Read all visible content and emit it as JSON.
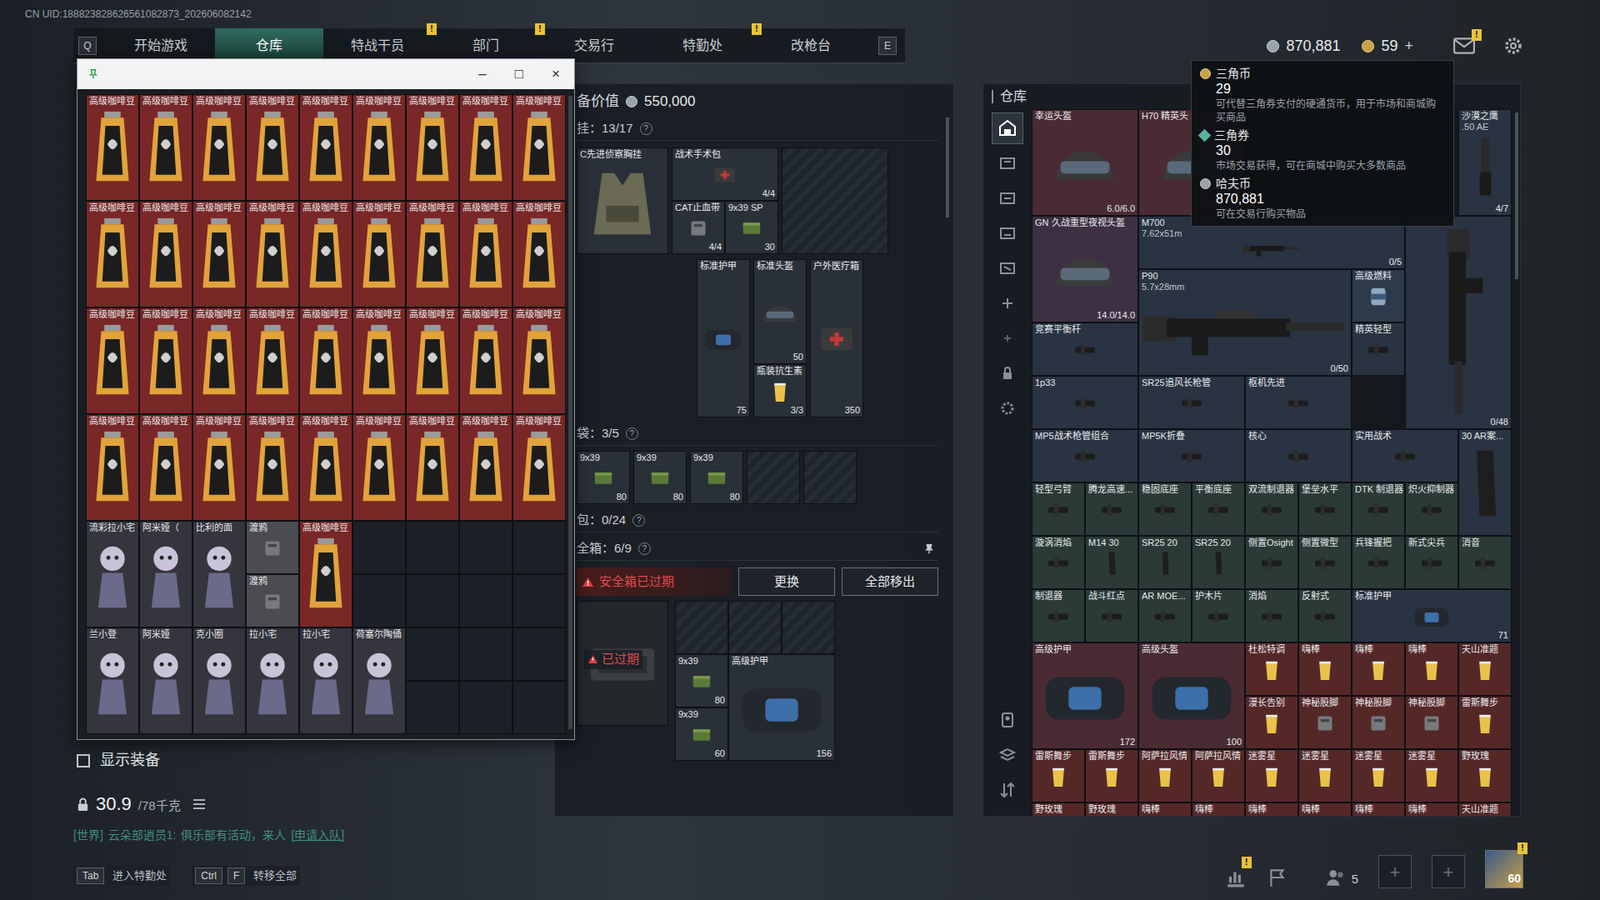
{
  "uid": "CN UID:188823828626561082873_202606082142",
  "nav": {
    "prev_key": "Q",
    "next_key": "E",
    "tabs": [
      {
        "label": "开始游戏",
        "selected": false
      },
      {
        "label": "仓库",
        "selected": true
      },
      {
        "label": "特战干员",
        "selected": false,
        "badge": "!"
      },
      {
        "label": "部门",
        "selected": false,
        "badge": "!"
      },
      {
        "label": "交易行",
        "selected": false
      },
      {
        "label": "特勤处",
        "selected": false,
        "badge": "!"
      },
      {
        "label": "改枪台",
        "selected": false
      }
    ]
  },
  "wallet": {
    "haf": "870,881",
    "coin": "59",
    "add": "+",
    "mail_badge": "!"
  },
  "tooltip": [
    {
      "name": "三角币",
      "value": "29",
      "desc": "可代替三角券支付的硬通货币，用于市场和商城购买商品"
    },
    {
      "name": "三角券",
      "value": "30",
      "desc": "市场交易获得，可在商城中购买大多数商品"
    },
    {
      "name": "哈夫币",
      "value": "870,881",
      "desc": "可在交易行购买物品"
    }
  ],
  "float_window": {
    "controls": [
      "–",
      "□",
      "×"
    ],
    "items": [
      {
        "name": "高级咖啡豆",
        "kind": "bean",
        "color": "#7a2727"
      },
      {
        "name": "高级咖啡豆",
        "kind": "bean",
        "color": "#7a2727"
      },
      {
        "name": "高级咖啡豆",
        "kind": "bean",
        "color": "#7a2727"
      },
      {
        "name": "高级咖啡豆",
        "kind": "bean",
        "color": "#7a2727"
      },
      {
        "name": "高级咖啡豆",
        "kind": "bean",
        "color": "#7a2727"
      },
      {
        "name": "高级咖啡豆",
        "kind": "bean",
        "color": "#7a2727"
      },
      {
        "name": "高级咖啡豆",
        "kind": "bean",
        "color": "#7a2727"
      },
      {
        "name": "高级咖啡豆",
        "kind": "bean",
        "color": "#7a2727"
      },
      {
        "name": "高级咖啡豆",
        "kind": "bean",
        "color": "#7a2727"
      },
      {
        "name": "高级咖啡豆",
        "kind": "bean",
        "color": "#7a2727"
      },
      {
        "name": "高级咖啡豆",
        "kind": "bean",
        "color": "#7a2727"
      },
      {
        "name": "高级咖啡豆",
        "kind": "bean",
        "color": "#7a2727"
      },
      {
        "name": "高级咖啡豆",
        "kind": "bean",
        "color": "#7a2727"
      },
      {
        "name": "高级咖啡豆",
        "kind": "bean",
        "color": "#7a2727"
      },
      {
        "name": "高级咖啡豆",
        "kind": "bean",
        "color": "#7a2727"
      },
      {
        "name": "高级咖啡豆",
        "kind": "bean",
        "color": "#7a2727"
      },
      {
        "name": "高级咖啡豆",
        "kind": "bean",
        "color": "#7a2727"
      },
      {
        "name": "高级咖啡豆",
        "kind": "bean",
        "color": "#7a2727"
      },
      {
        "name": "高级咖啡豆",
        "kind": "bean",
        "color": "#7a2727"
      },
      {
        "name": "高级咖啡豆",
        "kind": "bean",
        "color": "#7a2727"
      },
      {
        "name": "高级咖啡豆",
        "kind": "bean",
        "color": "#7a2727"
      },
      {
        "name": "高级咖啡豆",
        "kind": "bean",
        "color": "#7a2727"
      },
      {
        "name": "高级咖啡豆",
        "kind": "bean",
        "color": "#7a2727"
      },
      {
        "name": "高级咖啡豆",
        "kind": "bean",
        "color": "#7a2727"
      },
      {
        "name": "高级咖啡豆",
        "kind": "bean",
        "color": "#7a2727"
      },
      {
        "name": "高级咖啡豆",
        "kind": "bean",
        "color": "#7a2727"
      },
      {
        "name": "高级咖啡豆",
        "kind": "bean",
        "color": "#7a2727"
      },
      {
        "name": "高级咖啡豆",
        "kind": "bean",
        "color": "#7a2727"
      },
      {
        "name": "高级咖啡豆",
        "kind": "bean",
        "color": "#7a2727"
      },
      {
        "name": "高级咖啡豆",
        "kind": "bean",
        "color": "#7a2727"
      },
      {
        "name": "高级咖啡豆",
        "kind": "bean",
        "color": "#7a2727"
      },
      {
        "name": "高级咖啡豆",
        "kind": "bean",
        "color": "#7a2727"
      },
      {
        "name": "高级咖啡豆",
        "kind": "bean",
        "color": "#7a2727"
      },
      {
        "name": "高级咖啡豆",
        "kind": "bean",
        "color": "#7a2727"
      },
      {
        "name": "高级咖啡豆",
        "kind": "bean",
        "color": "#7a2727"
      },
      {
        "name": "高级咖啡豆",
        "kind": "bean",
        "color": "#7a2727"
      },
      {
        "name": "流彩拉小宅",
        "kind": "figure",
        "color": "#34353d"
      },
      {
        "name": "阿米娅（",
        "kind": "figure",
        "color": "#34353d"
      },
      {
        "name": "比利的面",
        "kind": "figure",
        "color": "#34353d"
      },
      {
        "name": "渡鸦",
        "kind": "misc",
        "color": "#4a4c50"
      },
      {
        "name": "渡鸦",
        "kind": "misc",
        "color": "#4a4c50"
      },
      {
        "name": "高级咖啡豆",
        "kind": "bean",
        "color": "#7a2727"
      },
      {
        "name": "兰小登",
        "kind": "figure",
        "color": "#34353d"
      },
      {
        "name": "阿米娅",
        "kind": "figure",
        "color": "#34353d"
      },
      {
        "name": "克小圈",
        "kind": "figure",
        "color": "#34353d"
      },
      {
        "name": "拉小宅",
        "kind": "figure",
        "color": "#34353d"
      },
      {
        "name": "拉小宅",
        "kind": "figure",
        "color": "#34353d"
      },
      {
        "name": "荷塞尔陶俑",
        "kind": "figure",
        "color": "#34353d"
      }
    ]
  },
  "equipment": {
    "value_label": "备价值",
    "value": "550,000",
    "rig": {
      "label": "挂：13/17",
      "help": "?",
      "items": [
        {
          "name": "C先进侦察胸挂",
          "kind": "rig"
        },
        {
          "name": "战术手术包",
          "count": "4/4",
          "kind": "medkit"
        },
        {
          "name": "CAT止血带",
          "count": "4/4",
          "kind": "misc"
        },
        {
          "name": "9x39 SP",
          "count": "30",
          "kind": "ammo"
        },
        {
          "name": "标准护甲",
          "count": "75",
          "kind": "armor"
        },
        {
          "name": "标准头盔",
          "count": "50",
          "kind": "helmet"
        },
        {
          "name": "瓶装抗生素",
          "count": "3/3",
          "kind": "drink"
        },
        {
          "name": "户外医疗箱",
          "count": "350",
          "kind": "medkit"
        }
      ]
    },
    "pockets": {
      "label": "袋：3/5",
      "help": "?",
      "slots": [
        {
          "filled": true,
          "name": "9x39",
          "count": "80",
          "kind": "ammo"
        },
        {
          "filled": true,
          "name": "9x39",
          "count": "80",
          "kind": "ammo"
        },
        {
          "filled": true,
          "name": "9x39",
          "count": "80",
          "kind": "ammo"
        },
        {
          "filled": false
        },
        {
          "filled": false
        }
      ]
    },
    "backpack": {
      "label": "包：0/24",
      "help": "?"
    },
    "safe": {
      "label": "全箱：6/9",
      "help": "?",
      "warning": "安全箱已过期",
      "buttons": [
        "更换",
        "全部移出"
      ],
      "expired": "已过期",
      "items": [
        {
          "name": "9x39",
          "count": "80",
          "kind": "ammo"
        },
        {
          "name": "9x39",
          "count": "60",
          "kind": "ammo"
        },
        {
          "name": "高级护甲",
          "count": "156",
          "kind": "armor"
        }
      ]
    }
  },
  "warehouse": {
    "title": "仓库",
    "sidebar": [
      {
        "selected": true
      },
      {
        "selected": false
      },
      {
        "selected": false
      },
      {
        "selected": false
      },
      {
        "selected": false
      },
      {
        "selected": false
      },
      {
        "selected": false
      },
      {
        "selected": false
      },
      {
        "selected": false
      },
      {
        "selected": false
      },
      {
        "selected": false
      },
      {
        "selected": false
      }
    ],
    "items": [
      {
        "name": "幸运头盔",
        "count": "6.0/6.0",
        "kind": "helmet",
        "color": "#4a2b34"
      },
      {
        "name": "H70 精英头",
        "kind": "helmet",
        "color": "#4a2b34"
      },
      {
        "name": "沙漠之鹰",
        "sub": ".50 AE",
        "count": "4/7",
        "kind": "pistol",
        "color": "#2a3342"
      },
      {
        "name": "GN 久战重型夜视头盔",
        "count": "14.0/14.0",
        "kind": "helmet",
        "color": "#3d3042"
      },
      {
        "name": "M700",
        "sub": "7.62x51m",
        "count": "0/5",
        "kind": "gun",
        "color": "#2a3342"
      },
      {
        "count": "0/48",
        "kind": "vgun",
        "color": "#2a3342"
      },
      {
        "name": "P90",
        "sub": "5.7x28mm",
        "count": "0/50",
        "kind": "gun",
        "color": "#2a3342"
      },
      {
        "name": "高级燃料",
        "kind": "can",
        "color": "#2d3a4c"
      },
      {
        "name": "精英轻型",
        "kind": "part",
        "color": "#2a3342"
      },
      {
        "name": "竞赛平衡杆",
        "kind": "part",
        "color": "#2a3342"
      },
      {
        "name": "1p33",
        "kind": "part",
        "color": "#2a3342"
      },
      {
        "name": "SR25追风长枪管",
        "kind": "part",
        "color": "#2a3342"
      },
      {
        "name": "枢机先进",
        "kind": "part",
        "color": "#2a3342"
      },
      {
        "name": "MP5战术枪管组合",
        "kind": "part",
        "color": "#2a3342"
      },
      {
        "name": "MP5K折叠",
        "kind": "part",
        "color": "#2a3342"
      },
      {
        "name": "核心",
        "kind": "part",
        "color": "#2a3342"
      },
      {
        "name": "实用战术",
        "kind": "part",
        "color": "#2a3342"
      },
      {
        "name": "30 AR案...",
        "kind": "mag",
        "color": "#2a3342"
      },
      {
        "name": "轻型弓臂",
        "kind": "part",
        "color": "#2b3a37"
      },
      {
        "name": "腾龙高速...",
        "kind": "part",
        "color": "#2b3a37"
      },
      {
        "name": "稳固底座",
        "kind": "part",
        "color": "#2b3a37"
      },
      {
        "name": "平衡底座",
        "kind": "part",
        "color": "#2b3a37"
      },
      {
        "name": "双流制退器",
        "kind": "part",
        "color": "#2b3a37"
      },
      {
        "name": "堡垒水平",
        "kind": "part",
        "color": "#2b3a37"
      },
      {
        "name": "DTK 制退器",
        "kind": "part",
        "color": "#2b3a37"
      },
      {
        "name": "炽火抑制器",
        "kind": "part",
        "color": "#2b3a37"
      },
      {
        "name": "漩涡消焰",
        "kind": "part",
        "color": "#2b3a37"
      },
      {
        "name": "M14 30",
        "kind": "mag",
        "color": "#2b3a37"
      },
      {
        "name": "SR25 20",
        "kind": "mag",
        "color": "#2b3a37"
      },
      {
        "name": "SR25 20",
        "kind": "mag",
        "color": "#2b3a37"
      },
      {
        "name": "侧置Osight",
        "kind": "part",
        "color": "#2b3a37"
      },
      {
        "name": "侧置微型",
        "kind": "part",
        "color": "#2b3a37"
      },
      {
        "name": "兵锋握把",
        "kind": "part",
        "color": "#2b3a37"
      },
      {
        "name": "新式尖兵",
        "kind": "part",
        "color": "#2b3a37"
      },
      {
        "name": "消音",
        "kind": "part",
        "color": "#2b3a37"
      },
      {
        "name": "制退器",
        "kind": "part",
        "color": "#2b3a37"
      },
      {
        "name": "战斗红点",
        "kind": "part",
        "color": "#2b3a37"
      },
      {
        "name": "AR MOE...",
        "kind": "part",
        "color": "#2b3a37"
      },
      {
        "name": "护木片",
        "kind": "part",
        "color": "#2b3a37"
      },
      {
        "name": "消焰",
        "kind": "part",
        "color": "#2b3a37"
      },
      {
        "name": "反射式",
        "kind": "part",
        "color": "#2b3a37"
      },
      {
        "name": "标准护甲",
        "count": "71",
        "kind": "armor",
        "color": "#2a3342"
      },
      {
        "name": "高级护甲",
        "count": "172",
        "kind": "armor",
        "color": "#4a2b34"
      },
      {
        "name": "高级头盔",
        "count": "100",
        "kind": "armor",
        "color": "#4a2b34"
      },
      {
        "name": "杜松特调",
        "kind": "drink",
        "color": "#552828"
      },
      {
        "name": "嗨棒",
        "kind": "drink",
        "color": "#552828"
      },
      {
        "name": "嗨棒",
        "kind": "drink",
        "color": "#552828"
      },
      {
        "name": "嗨棒",
        "kind": "drink",
        "color": "#552828"
      },
      {
        "name": "天山准题",
        "kind": "drink",
        "color": "#552828"
      },
      {
        "name": "漫长告别",
        "kind": "drink",
        "color": "#552828"
      },
      {
        "name": "神秘股脚",
        "kind": "misc",
        "color": "#552828"
      },
      {
        "name": "神秘股脚",
        "kind": "misc",
        "color": "#552828"
      },
      {
        "name": "神秘股脚",
        "kind": "misc",
        "color": "#552828"
      },
      {
        "name": "雷斯舞步",
        "kind": "drink",
        "color": "#552828"
      },
      {
        "name": "雷斯舞步",
        "kind": "drink",
        "color": "#552828"
      },
      {
        "name": "雷斯舞步",
        "kind": "drink",
        "color": "#552828"
      },
      {
        "name": "阿萨拉风情",
        "kind": "drink",
        "color": "#552828"
      },
      {
        "name": "阿萨拉风情",
        "kind": "drink",
        "color": "#552828"
      },
      {
        "name": "迷雾星",
        "kind": "drink",
        "color": "#552828"
      },
      {
        "name": "迷雾星",
        "kind": "drink",
        "color": "#552828"
      },
      {
        "name": "迷雾星",
        "kind": "drink",
        "color": "#552828"
      },
      {
        "name": "迷雾星",
        "kind": "drink",
        "color": "#552828"
      },
      {
        "name": "野玫瑰",
        "kind": "drink",
        "color": "#552828"
      },
      {
        "name": "野玫瑰",
        "kind": "drink",
        "color": "#552828"
      },
      {
        "name": "野玫瑰",
        "kind": "drink",
        "color": "#552828"
      },
      {
        "name": "嗨棒",
        "kind": "drink",
        "color": "#552828"
      },
      {
        "name": "嗨棒",
        "kind": "drink",
        "color": "#552828"
      },
      {
        "name": "嗨棒",
        "kind": "drink",
        "color": "#552828"
      },
      {
        "name": "嗨棒",
        "kind": "drink",
        "color": "#552828"
      },
      {
        "name": "嗨棒",
        "kind": "drink",
        "color": "#552828"
      },
      {
        "name": "嗨棒",
        "kind": "drink",
        "color": "#552828"
      },
      {
        "name": "天山准题",
        "kind": "drink",
        "color": "#552828"
      }
    ]
  },
  "left_panel": {
    "show_equipment": {
      "label": "显示装备",
      "checked": false
    },
    "weight": {
      "value": "30.9",
      "capacity": "/78千克"
    }
  },
  "chat": {
    "channel": "[世界]",
    "sender": "云朵部逍员1:",
    "message": "俱乐部有活动，来人",
    "action": "[申请入队]"
  },
  "hotkeys": [
    {
      "keys": [
        "Tab"
      ],
      "label": "进入特勤处"
    },
    {
      "keys": [
        "Ctrl",
        "F"
      ],
      "label": "转移全部"
    }
  ],
  "bottom_right": {
    "stats_badge": "!",
    "friends": "5",
    "slots": [
      "+",
      "+"
    ],
    "level": "60",
    "avatar_badge": "!"
  }
}
